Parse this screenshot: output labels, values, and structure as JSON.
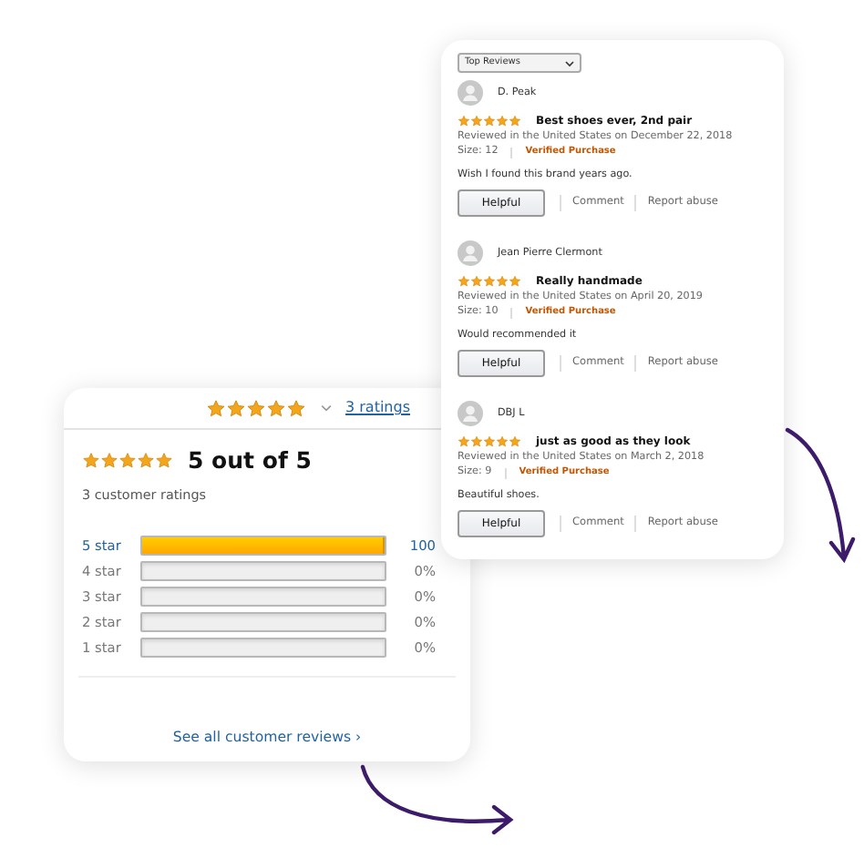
{
  "reviews_panel": {
    "sort_select": {
      "value": "Top Reviews"
    },
    "reviews": [
      {
        "author": "D. Peak",
        "stars": 5,
        "title": "Best shoes ever, 2nd pair",
        "meta": "Reviewed in the United States on December 22, 2018",
        "size": "Size: 12",
        "badge": "Verified Purchase",
        "body": "Wish I found this brand years ago.",
        "buttons": [
          "Helpful",
          "Comment",
          "Report abuse"
        ]
      },
      {
        "author": "Jean Pierre Clermont",
        "stars": 5,
        "title": "Really handmade",
        "meta": "Reviewed in the United States on April 20, 2019",
        "size": "Size: 10",
        "badge": "Verified Purchase",
        "body": "Would recommended it",
        "buttons": [
          "Helpful",
          "Comment",
          "Report abuse"
        ]
      },
      {
        "author": "DBJ L",
        "stars": 5,
        "title": "just as good as they look",
        "meta": "Reviewed in the United States on March 2, 2018",
        "size": "Size: 9",
        "badge": "Verified Purchase",
        "body": "Beautiful shoes.",
        "buttons": [
          "Helpful",
          "Comment",
          "Report abuse"
        ]
      }
    ]
  },
  "ratings_panel": {
    "header": {
      "stars": 5
    },
    "ratings_link": "3 ratings",
    "stars": 5,
    "score": "5 out of 5",
    "count": "3 customer ratings",
    "bars": [
      {
        "label": "5 star",
        "level": 1,
        "percent": "100",
        "linked": true
      },
      {
        "label": "4 star",
        "level": 0,
        "percent": "0%",
        "linked": false
      },
      {
        "label": "3 star",
        "level": 0,
        "percent": "0%",
        "linked": false
      },
      {
        "label": "2 star",
        "level": 0,
        "percent": "0%",
        "linked": false
      },
      {
        "label": "1 star",
        "level": 0,
        "percent": "0%",
        "linked": false
      }
    ],
    "link": "See all customer reviews ›"
  }
}
